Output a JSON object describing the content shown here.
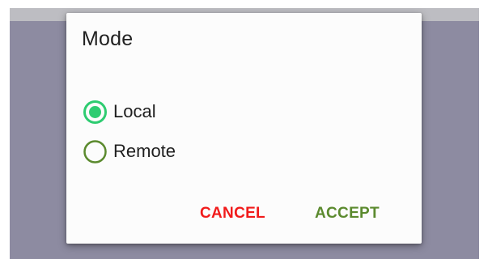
{
  "dialog": {
    "title": "Mode",
    "options": [
      {
        "label": "Local",
        "selected": true
      },
      {
        "label": "Remote",
        "selected": false
      }
    ],
    "cancel_label": "CANCEL",
    "accept_label": "ACCEPT"
  },
  "colors": {
    "scrim": "#8d8ba1",
    "radio_selected_fill": "#2ecc71",
    "radio_unselected_ring": "#5b8a2e",
    "cancel": "#f11b1b",
    "accept": "#5b8a2e"
  },
  "icons": {
    "selected": "radio-selected-icon",
    "unselected": "radio-unselected-icon"
  }
}
